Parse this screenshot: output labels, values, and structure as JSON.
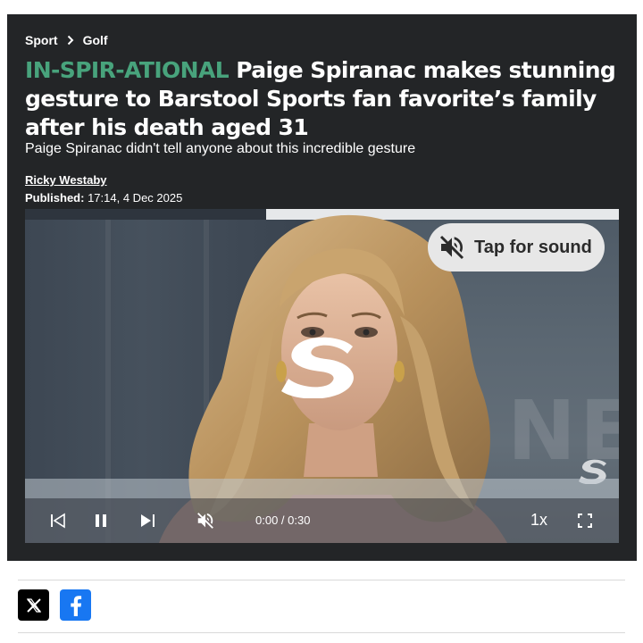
{
  "breadcrumb": {
    "section": "Sport",
    "subsection": "Golf"
  },
  "headline": {
    "kicker": "IN-SPIR-ATIONAL",
    "text": "Paige Spiranac makes stunning gesture to Barstool Sports fan favorite’s family after his death aged 31"
  },
  "standfirst": "Paige Spiranac didn't tell anyone about this incredible gesture",
  "byline": {
    "author": "Ricky Westaby",
    "published_label": "Published:",
    "published_value": "17:14, 4 Dec 2025"
  },
  "video": {
    "sound_prompt": "Tap for sound",
    "time": "0:00 / 0:30",
    "playback_rate": "1x",
    "background_wordmark": "NETFL",
    "progress_fraction": 0.0
  },
  "icons": {
    "breadcrumb_separator": "chevron-right-icon",
    "sound": "volume-off-icon",
    "skip_back": "skip-previous-icon",
    "pause": "pause-icon",
    "skip_next": "skip-next-icon",
    "mute": "volume-off-icon",
    "fullscreen": "fullscreen-icon",
    "share_x": "x-logo-icon",
    "share_facebook": "facebook-logo-icon"
  },
  "colors": {
    "header_bg": "#232527",
    "kicker": "#48a37c",
    "facebook": "#1877f2",
    "x": "#000000"
  }
}
